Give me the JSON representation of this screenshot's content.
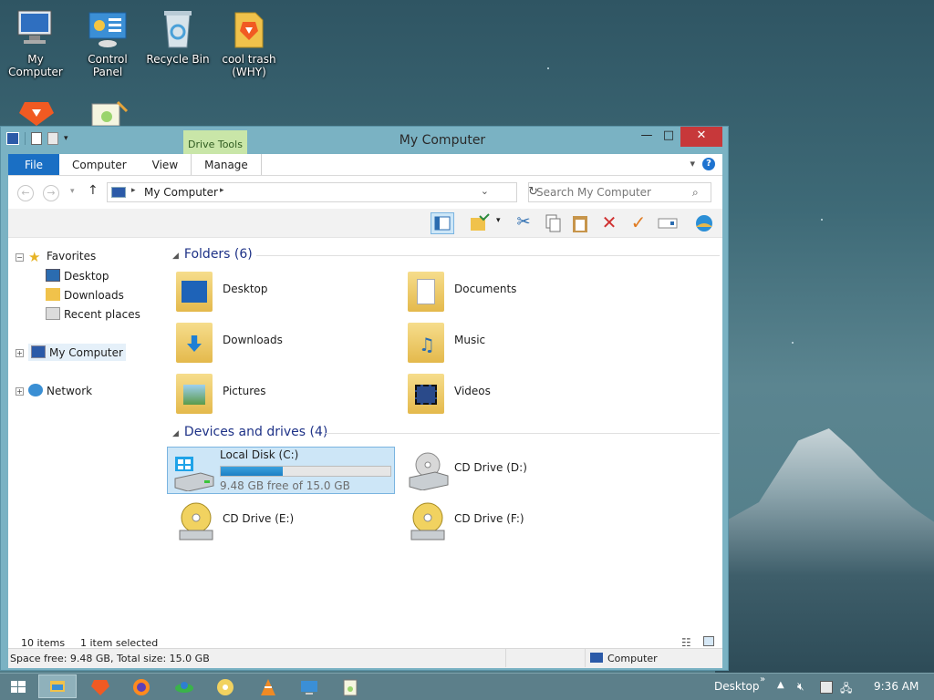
{
  "desktop": {
    "icons": [
      {
        "label": "My Computer"
      },
      {
        "label": "Control Panel"
      },
      {
        "label": "Recycle Bin"
      },
      {
        "label": "cool trash (WHY)"
      }
    ]
  },
  "window": {
    "title": "My Computer",
    "context_tab": "Drive Tools",
    "controls": {
      "minimize": "—",
      "maximize": "□",
      "close": "✕"
    },
    "tabs": [
      "File",
      "Computer",
      "View",
      "Manage"
    ],
    "address": {
      "crumb": "My Computer"
    },
    "search_placeholder": "Search My Computer",
    "help": "?"
  },
  "nav": {
    "favorites": "Favorites",
    "fav_items": [
      "Desktop",
      "Downloads",
      "Recent places"
    ],
    "my_computer": "My Computer",
    "network": "Network"
  },
  "main": {
    "folders_header": "Folders (6)",
    "folders": [
      "Desktop",
      "Documents",
      "Downloads",
      "Music",
      "Pictures",
      "Videos"
    ],
    "devices_header": "Devices and drives (4)",
    "drives": [
      {
        "label": "Local Disk (C:)",
        "detail": "9.48 GB free of 15.0 GB",
        "used_fraction": 0.368
      },
      {
        "label": "CD Drive (D:)"
      },
      {
        "label": "CD Drive (E:)"
      },
      {
        "label": "CD Drive (F:)"
      }
    ]
  },
  "status": {
    "items": "10 items",
    "selected": "1 item selected",
    "space": "Space free: 9.48 GB, Total size: 15.0 GB",
    "location": "Computer"
  },
  "taskbar": {
    "desktop_label": "Desktop",
    "time": "9:36 AM"
  },
  "colors": {
    "accent": "#1a6fc4",
    "title_bar": "#7ab2c3",
    "close": "#c7383a",
    "selection": "#cde6f7"
  }
}
